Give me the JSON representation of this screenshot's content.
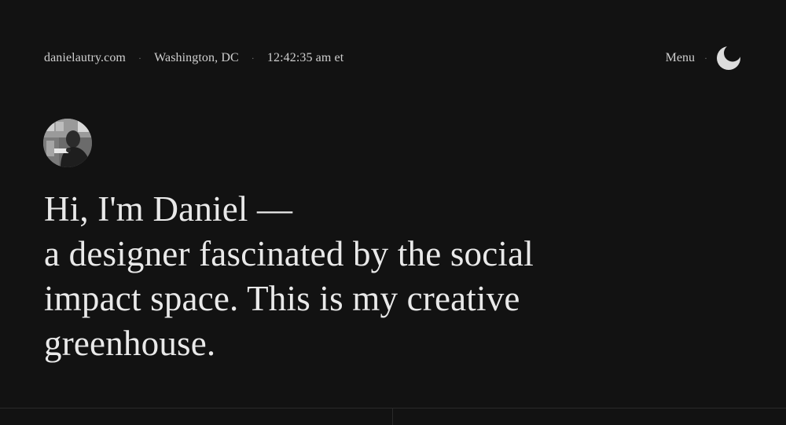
{
  "header": {
    "site": "danielautry.com",
    "location": "Washington, DC",
    "time": "12:42:35 am et",
    "separator": "·",
    "menu_label": "Menu",
    "theme_icon": "moon-icon"
  },
  "hero": {
    "avatar_icon": "avatar",
    "lines": [
      "Hi, I'm Daniel —",
      "a designer fascinated by the social",
      "impact space. This is my creative",
      "greenhouse."
    ]
  },
  "colors": {
    "background": "#121212",
    "text": "#e6e6e6",
    "muted": "#cfcfcf",
    "separator": "#7a7a7a"
  }
}
